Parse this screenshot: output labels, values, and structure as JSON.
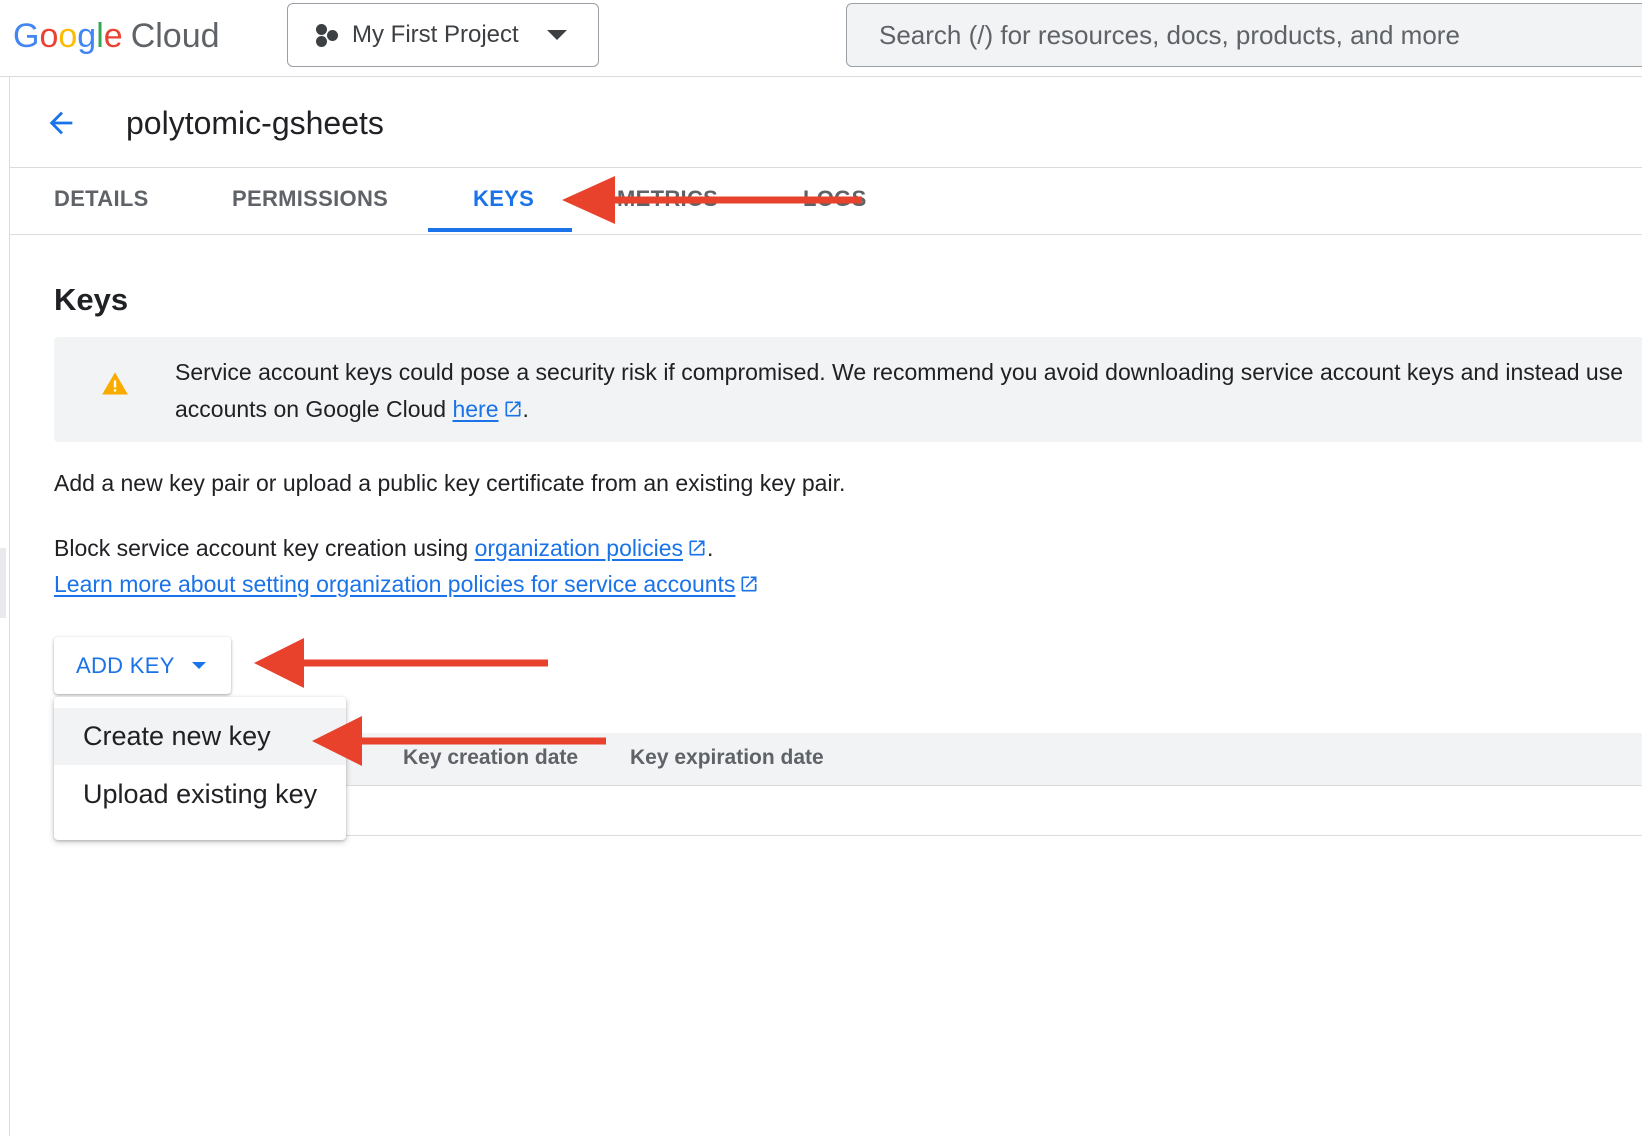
{
  "topbar": {
    "logo_word": "Google",
    "logo_cloud": "Cloud",
    "logo_colors": [
      "#4285F4",
      "#EA4335",
      "#FBBC05",
      "#4285F4",
      "#34A853",
      "#EA4335"
    ],
    "project_name": "My First Project",
    "search_placeholder": "Search (/) for resources, docs, products, and more"
  },
  "header": {
    "title": "polytomic-gsheets",
    "back_icon": "arrow-back-icon"
  },
  "tabs": [
    {
      "label": "DETAILS",
      "active": false
    },
    {
      "label": "PERMISSIONS",
      "active": false
    },
    {
      "label": "KEYS",
      "active": true
    },
    {
      "label": "METRICS",
      "active": false
    },
    {
      "label": "LOGS",
      "active": false
    }
  ],
  "keys": {
    "title": "Keys",
    "warning_line1": "Service account keys could pose a security risk if compromised. We recommend you avoid downloading service account keys and instead use",
    "warning_line2_prefix": "accounts on Google Cloud ",
    "warning_link": "here",
    "warning_suffix": ".",
    "add_desc": "Add a new key pair or upload a public key certificate from an existing key pair.",
    "block_prefix": "Block service account key creation using ",
    "block_link": "organization policies",
    "block_suffix": ".",
    "learn_more": "Learn more about setting organization policies for service accounts",
    "add_key_label": "ADD KEY",
    "menu": [
      "Create new key",
      "Upload existing key"
    ],
    "columns": [
      "Key creation date",
      "Key expiration date"
    ]
  },
  "colors": {
    "accent": "#1a73e8",
    "warning": "#F9AB00",
    "annotation": "#E8412C"
  }
}
